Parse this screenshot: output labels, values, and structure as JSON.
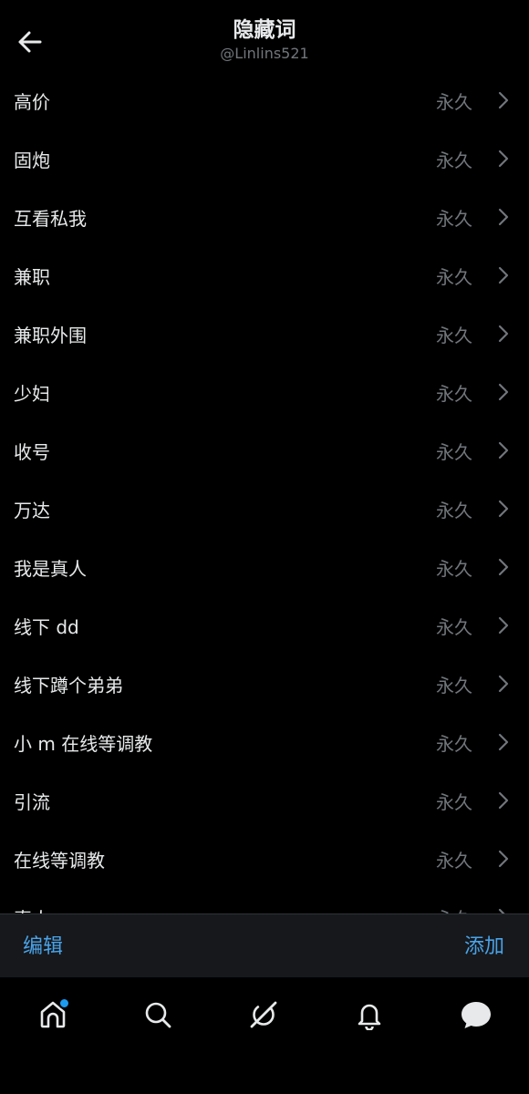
{
  "header": {
    "title": "隐藏词",
    "subtitle": "@Linlins521"
  },
  "muted_words": [
    {
      "word": "高价",
      "duration": "永久"
    },
    {
      "word": "固炮",
      "duration": "永久"
    },
    {
      "word": "互看私我",
      "duration": "永久"
    },
    {
      "word": "兼职",
      "duration": "永久"
    },
    {
      "word": "兼职外围",
      "duration": "永久"
    },
    {
      "word": "少妇",
      "duration": "永久"
    },
    {
      "word": "收号",
      "duration": "永久"
    },
    {
      "word": "万达",
      "duration": "永久"
    },
    {
      "word": "我是真人",
      "duration": "永久"
    },
    {
      "word": "线下 dd",
      "duration": "永久"
    },
    {
      "word": "线下蹲个弟弟",
      "duration": "永久"
    },
    {
      "word": "小 m 在线等调教",
      "duration": "永久"
    },
    {
      "word": "引流",
      "duration": "永久"
    },
    {
      "word": "在线等调教",
      "duration": "永久"
    },
    {
      "word": "真人",
      "duration": "永久"
    }
  ],
  "actions": {
    "edit": "编辑",
    "add": "添加"
  },
  "colors": {
    "background": "#000000",
    "accent": "#1d9bf0",
    "secondary_text": "#71767b"
  },
  "tabs": [
    {
      "name": "home",
      "icon": "home-icon",
      "notification": true
    },
    {
      "name": "search",
      "icon": "search-icon",
      "notification": false
    },
    {
      "name": "grok",
      "icon": "grok-icon",
      "notification": false
    },
    {
      "name": "notifications",
      "icon": "bell-icon",
      "notification": false
    },
    {
      "name": "messages",
      "icon": "chat-bubble-icon",
      "notification": false
    }
  ]
}
